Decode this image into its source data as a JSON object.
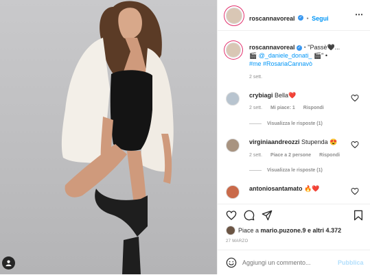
{
  "post": {
    "username": "roscannavoreal",
    "follow_label": "Segui",
    "caption_text": "\"Passè🖤...",
    "caption_handle": "@_daniele_donati_",
    "caption_hashtags": "#me #RosariaCannavò",
    "caption_time": "2 sett."
  },
  "comments": [
    {
      "user": "crybiagi",
      "text": "Bella❤️",
      "time": "2 sett.",
      "likes": "Mi piace: 1",
      "reply": "Rispondi",
      "view_replies": "Visualizza le risposte (1)"
    },
    {
      "user": "virginiaandreozzi",
      "text": "Stupenda 😍",
      "time": "2 sett.",
      "likes": "Piace a 2 persone",
      "reply": "Rispondi",
      "view_replies": "Visualizza le risposte (1)"
    },
    {
      "user": "antoniosantamato",
      "text": "🔥❤️"
    }
  ],
  "likes_line": {
    "prefix": "Piace a ",
    "name": "mario.puzone.9",
    "suffix": " e altri 4.372"
  },
  "date": "27 MARZO",
  "add_comment_placeholder": "Aggiungi un commento...",
  "publish_label": "Pubblica",
  "colors": {
    "accent": "#0095f6",
    "heart": "#ed4956"
  }
}
